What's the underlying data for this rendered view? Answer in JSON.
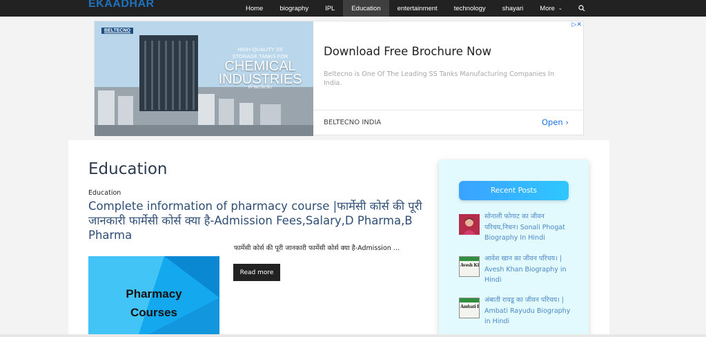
{
  "site": {
    "logo": "EKAADHAR"
  },
  "nav": {
    "items": [
      {
        "label": "Home",
        "active": false
      },
      {
        "label": "biography",
        "active": false
      },
      {
        "label": "IPL",
        "active": false
      },
      {
        "label": "Education",
        "active": true
      },
      {
        "label": "entertainment",
        "active": false
      },
      {
        "label": "technology",
        "active": false
      },
      {
        "label": "shayari",
        "active": false
      }
    ],
    "more_label": "More",
    "more_icon": "chevron-down-icon",
    "search_icon": "search-icon"
  },
  "ad": {
    "brand": "BELTECNO",
    "image_line1": "HIGH-QUALITY SS",
    "image_line2": "STORAGE TANKS FOR",
    "image_big": "CHEMICAL INDUSTRIES",
    "image_by": "BY BELTECNO",
    "headline": "Download Free Brochure Now",
    "description": "Beltecno is One Of The Leading SS Tanks Manufacturing Companies In India.",
    "advertiser": "BELTECNO INDIA",
    "cta": "Open",
    "choices_icon": "ad-choices-icon",
    "accent": "#1a73e8"
  },
  "main": {
    "page_title": "Education",
    "post": {
      "category": "Education",
      "title": "Complete information of pharmacy course |फार्मेसी कोर्स की पूरी जानकारी फार्मेसी कोर्स क्या है-Admission Fees,Salary,D Pharma,B Pharma",
      "thumb_line1": "Pharmacy",
      "thumb_line2": "Courses",
      "excerpt": "फार्मेसी कोर्स की पूरी जानकारी फार्मेसी कोर्स क्या है-Admission …",
      "read_more": "Read more"
    }
  },
  "sidebar": {
    "title": "Recent Posts",
    "posts": [
      {
        "title": "सोनाली फोगाट का जीवन परिचय,निधन। Sonali Phogat Biography In Hindi",
        "thumb_label": ""
      },
      {
        "title": "आवेश खान का जीवन परिचय। | Avesh Khan Biography in Hindi",
        "thumb_label": "Avesh Kh Biograp"
      },
      {
        "title": "अंबाती रायडू का जीवन परिचय। | Ambati Rayudu Biography in Hindi",
        "thumb_label": "Ambati R Biogra"
      }
    ]
  },
  "colors": {
    "nav_bg": "#222222",
    "logo": "#1e73be",
    "title": "#2f4e75",
    "link": "#4b87c4",
    "sidebar_bg": "#e2fafe",
    "button_bg": "#222222"
  }
}
